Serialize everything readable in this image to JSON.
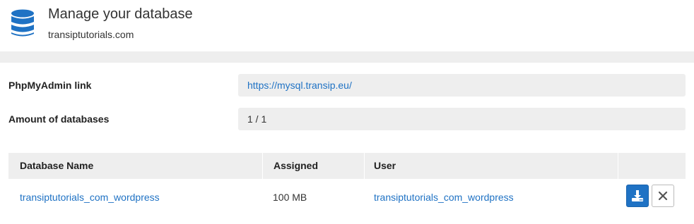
{
  "header": {
    "title": "Manage your database",
    "subtitle": "transiptutorials.com",
    "icon": "database-icon"
  },
  "info": {
    "phpmyadmin": {
      "label": "PhpMyAdmin link",
      "value": "https://mysql.transip.eu/"
    },
    "databases": {
      "label": "Amount of databases",
      "value": "1 / 1"
    }
  },
  "table": {
    "columns": [
      "Database Name",
      "Assigned",
      "User",
      ""
    ],
    "rows": [
      {
        "name": "transiptutorials_com_wordpress",
        "assigned": "100 MB",
        "user": "transiptutorials_com_wordpress",
        "actions": [
          "download-icon",
          "close-icon"
        ]
      }
    ]
  },
  "colors": {
    "accent": "#1f72c4",
    "band": "#eeeeee"
  }
}
